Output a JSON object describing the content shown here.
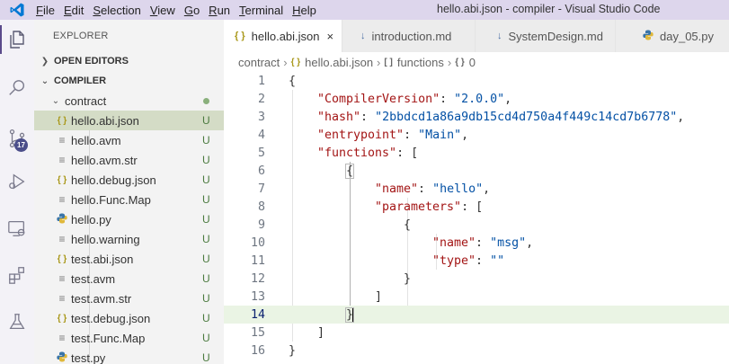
{
  "titlebar": {
    "menu": [
      {
        "acc": "F",
        "rest": "ile"
      },
      {
        "acc": "E",
        "rest": "dit"
      },
      {
        "acc": "S",
        "rest": "election"
      },
      {
        "acc": "V",
        "rest": "iew"
      },
      {
        "acc": "G",
        "rest": "o"
      },
      {
        "acc": "R",
        "rest": "un"
      },
      {
        "acc": "T",
        "rest": "erminal"
      },
      {
        "acc": "H",
        "rest": "elp"
      }
    ],
    "window_title": "hello.abi.json - compiler - Visual Studio Code"
  },
  "activitybar": {
    "items": [
      "explorer-icon",
      "search-icon",
      "source-control-icon",
      "run-debug-icon",
      "remote-explorer-icon",
      "extensions-icon",
      "testing-icon"
    ],
    "source_control_badge": "17"
  },
  "sidebar": {
    "title": "EXPLORER",
    "open_editors": "OPEN EDITORS",
    "workspace": "COMPILER",
    "folder": "contract",
    "files": [
      {
        "name": "hello.abi.json",
        "type": "json",
        "status": "U",
        "selected": true
      },
      {
        "name": "hello.avm",
        "type": "txt",
        "status": "U"
      },
      {
        "name": "hello.avm.str",
        "type": "txt",
        "status": "U"
      },
      {
        "name": "hello.debug.json",
        "type": "json",
        "status": "U"
      },
      {
        "name": "hello.Func.Map",
        "type": "txt",
        "status": "U"
      },
      {
        "name": "hello.py",
        "type": "py",
        "status": "U"
      },
      {
        "name": "hello.warning",
        "type": "txt",
        "status": "U"
      },
      {
        "name": "test.abi.json",
        "type": "json",
        "status": "U"
      },
      {
        "name": "test.avm",
        "type": "txt",
        "status": "U"
      },
      {
        "name": "test.avm.str",
        "type": "txt",
        "status": "U"
      },
      {
        "name": "test.debug.json",
        "type": "json",
        "status": "U"
      },
      {
        "name": "test.Func.Map",
        "type": "txt",
        "status": "U"
      },
      {
        "name": "test.py",
        "type": "py",
        "status": "U"
      }
    ]
  },
  "tabs": [
    {
      "label": "hello.abi.json",
      "icon": "{ }",
      "type": "json",
      "active": true,
      "close": "×"
    },
    {
      "label": "introduction.md",
      "icon": "↓",
      "type": "md"
    },
    {
      "label": "SystemDesign.md",
      "icon": "↓",
      "type": "md"
    },
    {
      "label": "day_05.py",
      "icon": "py",
      "type": "py"
    }
  ],
  "breadcrumb": {
    "folder": "contract",
    "file": "hello.abi.json",
    "file_icon": "{ }",
    "symbol": "functions",
    "symbol_icon": "[ ]",
    "index": "0",
    "index_icon": "{ }"
  },
  "editor": {
    "lines": [
      "1",
      "2",
      "3",
      "4",
      "5",
      "6",
      "7",
      "8",
      "9",
      "10",
      "11",
      "12",
      "13",
      "14",
      "15",
      "16"
    ],
    "current_line": "14",
    "code": {
      "l1": "{",
      "l2_key": "\"CompilerVersion\"",
      "l2_val": "\"2.0.0\"",
      "l3_key": "\"hash\"",
      "l3_val": "\"2bbdcd1a86a9db15cd4d750a4f449c14cd7b6778\"",
      "l4_key": "\"entrypoint\"",
      "l4_val": "\"Main\"",
      "l5_key": "\"functions\"",
      "l5_open": "[",
      "l6": "{",
      "l7_key": "\"name\"",
      "l7_val": "\"hello\"",
      "l8_key": "\"parameters\"",
      "l8_open": "[",
      "l9": "{",
      "l10_key": "\"name\"",
      "l10_val": "\"msg\"",
      "l11_key": "\"type\"",
      "l11_val": "\"\"",
      "l12": "}",
      "l13": "]",
      "l14": "}",
      "l15": "]",
      "l16": "}"
    }
  },
  "colors": {
    "titlebar_bg": "#ddd6ec",
    "activity_bg": "#f3f2f7",
    "sidebar_bg": "#f3f3f3",
    "selected_row": "#d4dcc6",
    "json_key": "#a31515",
    "json_string": "#0451a5",
    "current_line": "#eaf4e4",
    "vscode_blue": "#0078d4"
  }
}
